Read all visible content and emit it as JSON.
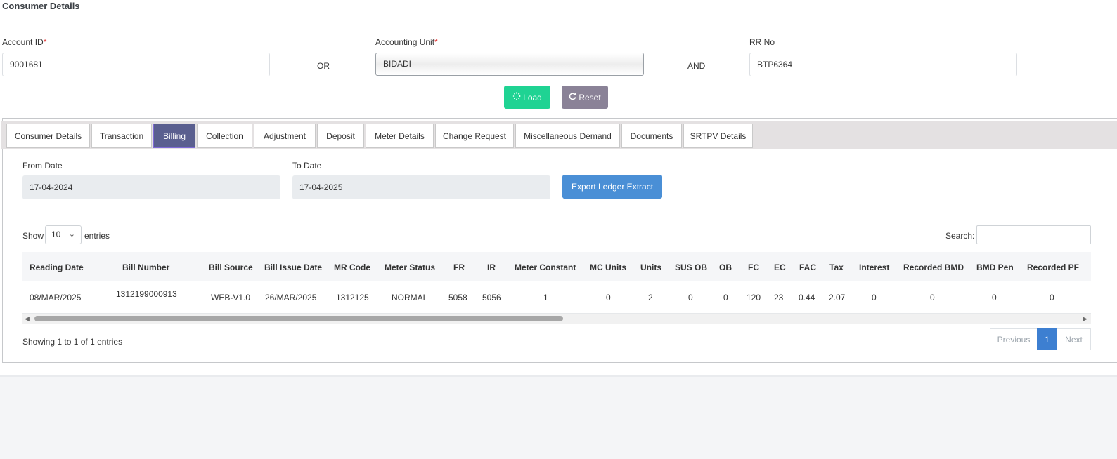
{
  "header": {
    "title": "Consumer Details"
  },
  "search_form": {
    "account_id": {
      "label": "Account ID",
      "required_mark": "*",
      "value": "9001681"
    },
    "or_text": "OR",
    "accounting_unit": {
      "label": "Accounting Unit",
      "required_mark": "*",
      "value": "BIDADI"
    },
    "and_text": "AND",
    "rr_no": {
      "label": "RR No",
      "value": "BTP6364"
    },
    "load_label": "Load",
    "reset_label": "Reset"
  },
  "tabs": [
    {
      "label": "Consumer Details"
    },
    {
      "label": "Transaction"
    },
    {
      "label": "Billing",
      "active": true
    },
    {
      "label": "Collection"
    },
    {
      "label": "Adjustment"
    },
    {
      "label": "Deposit"
    },
    {
      "label": "Meter Details"
    },
    {
      "label": "Change Request"
    },
    {
      "label": "Miscellaneous Demand"
    },
    {
      "label": "Documents"
    },
    {
      "label": "SRTPV Details"
    }
  ],
  "billing": {
    "from_date": {
      "label": "From Date",
      "value": "17-04-2024"
    },
    "to_date": {
      "label": "To Date",
      "value": "17-04-2025"
    },
    "export_label": "Export Ledger Extract",
    "table_controls": {
      "show_label": "Show",
      "entries_value": "10",
      "entries_label": "entries",
      "search_label": "Search:"
    },
    "columns": [
      "Reading Date",
      "Bill Number",
      "Bill Source",
      "Bill Issue Date",
      "MR Code",
      "Meter Status",
      "FR",
      "IR",
      "Meter Constant",
      "MC Units",
      "Units",
      "SUS OB",
      "OB",
      "FC",
      "EC",
      "FAC",
      "Tax",
      "Interest",
      "Recorded BMD",
      "BMD Pen",
      "Recorded PF"
    ],
    "rows": [
      [
        "08/MAR/2025",
        "1312199000913",
        "WEB-V1.0",
        "26/MAR/2025",
        "1312125",
        "NORMAL",
        "5058",
        "5056",
        "1",
        "0",
        "2",
        "0",
        "0",
        "120",
        "23",
        "0.44",
        "2.07",
        "0",
        "0",
        "0",
        "0"
      ]
    ],
    "footer": {
      "info": "Showing 1 to 1 of 1 entries",
      "previous": "Previous",
      "current_page": "1",
      "next": "Next"
    }
  },
  "colors": {
    "load_button": "#1fd393",
    "reset_button": "#8a8297",
    "active_tab": "#5a5f8f",
    "export_button": "#4a8fd6",
    "active_page": "#3d7fd1",
    "required": "#e03131"
  }
}
